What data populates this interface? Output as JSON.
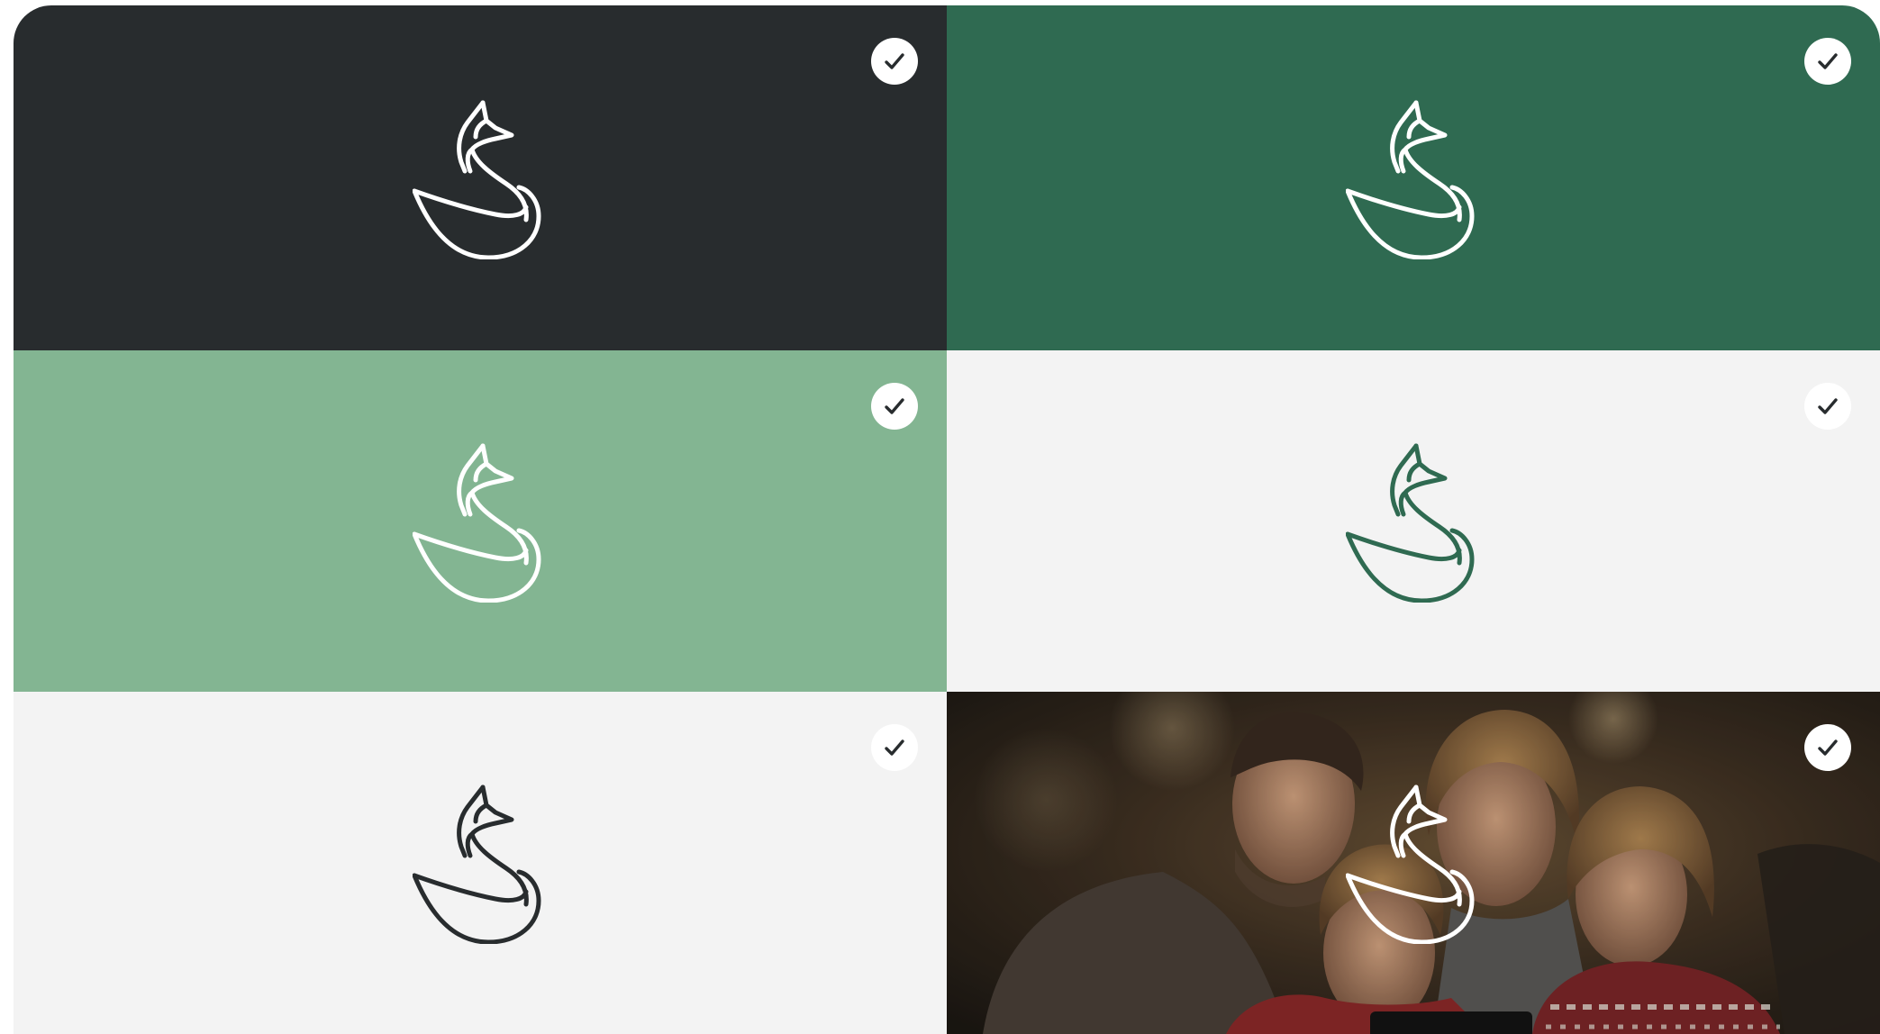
{
  "tiles": [
    {
      "name": "tile-dark",
      "background": "#282c2e",
      "logo_color": "#ffffff",
      "check_icon": "checkmark-icon",
      "selected": true
    },
    {
      "name": "tile-forest-green",
      "background": "#2f6a51",
      "logo_color": "#ffffff",
      "check_icon": "checkmark-icon",
      "selected": true
    },
    {
      "name": "tile-sage-green",
      "background": "#83b592",
      "logo_color": "#ffffff",
      "check_icon": "checkmark-icon",
      "selected": true
    },
    {
      "name": "tile-light-green-logo",
      "background": "#f3f3f3",
      "logo_color": "#2f6a51",
      "check_icon": "checkmark-icon",
      "selected": true
    },
    {
      "name": "tile-light-dark-logo",
      "background": "#f3f3f3",
      "logo_color": "#282c2e",
      "check_icon": "checkmark-icon",
      "selected": true
    },
    {
      "name": "tile-family-photo",
      "background": "photo",
      "logo_color": "#ffffff",
      "check_icon": "checkmark-icon",
      "selected": true
    }
  ],
  "logo_icon": "fox-logo-icon",
  "check_color": "#282c2e"
}
